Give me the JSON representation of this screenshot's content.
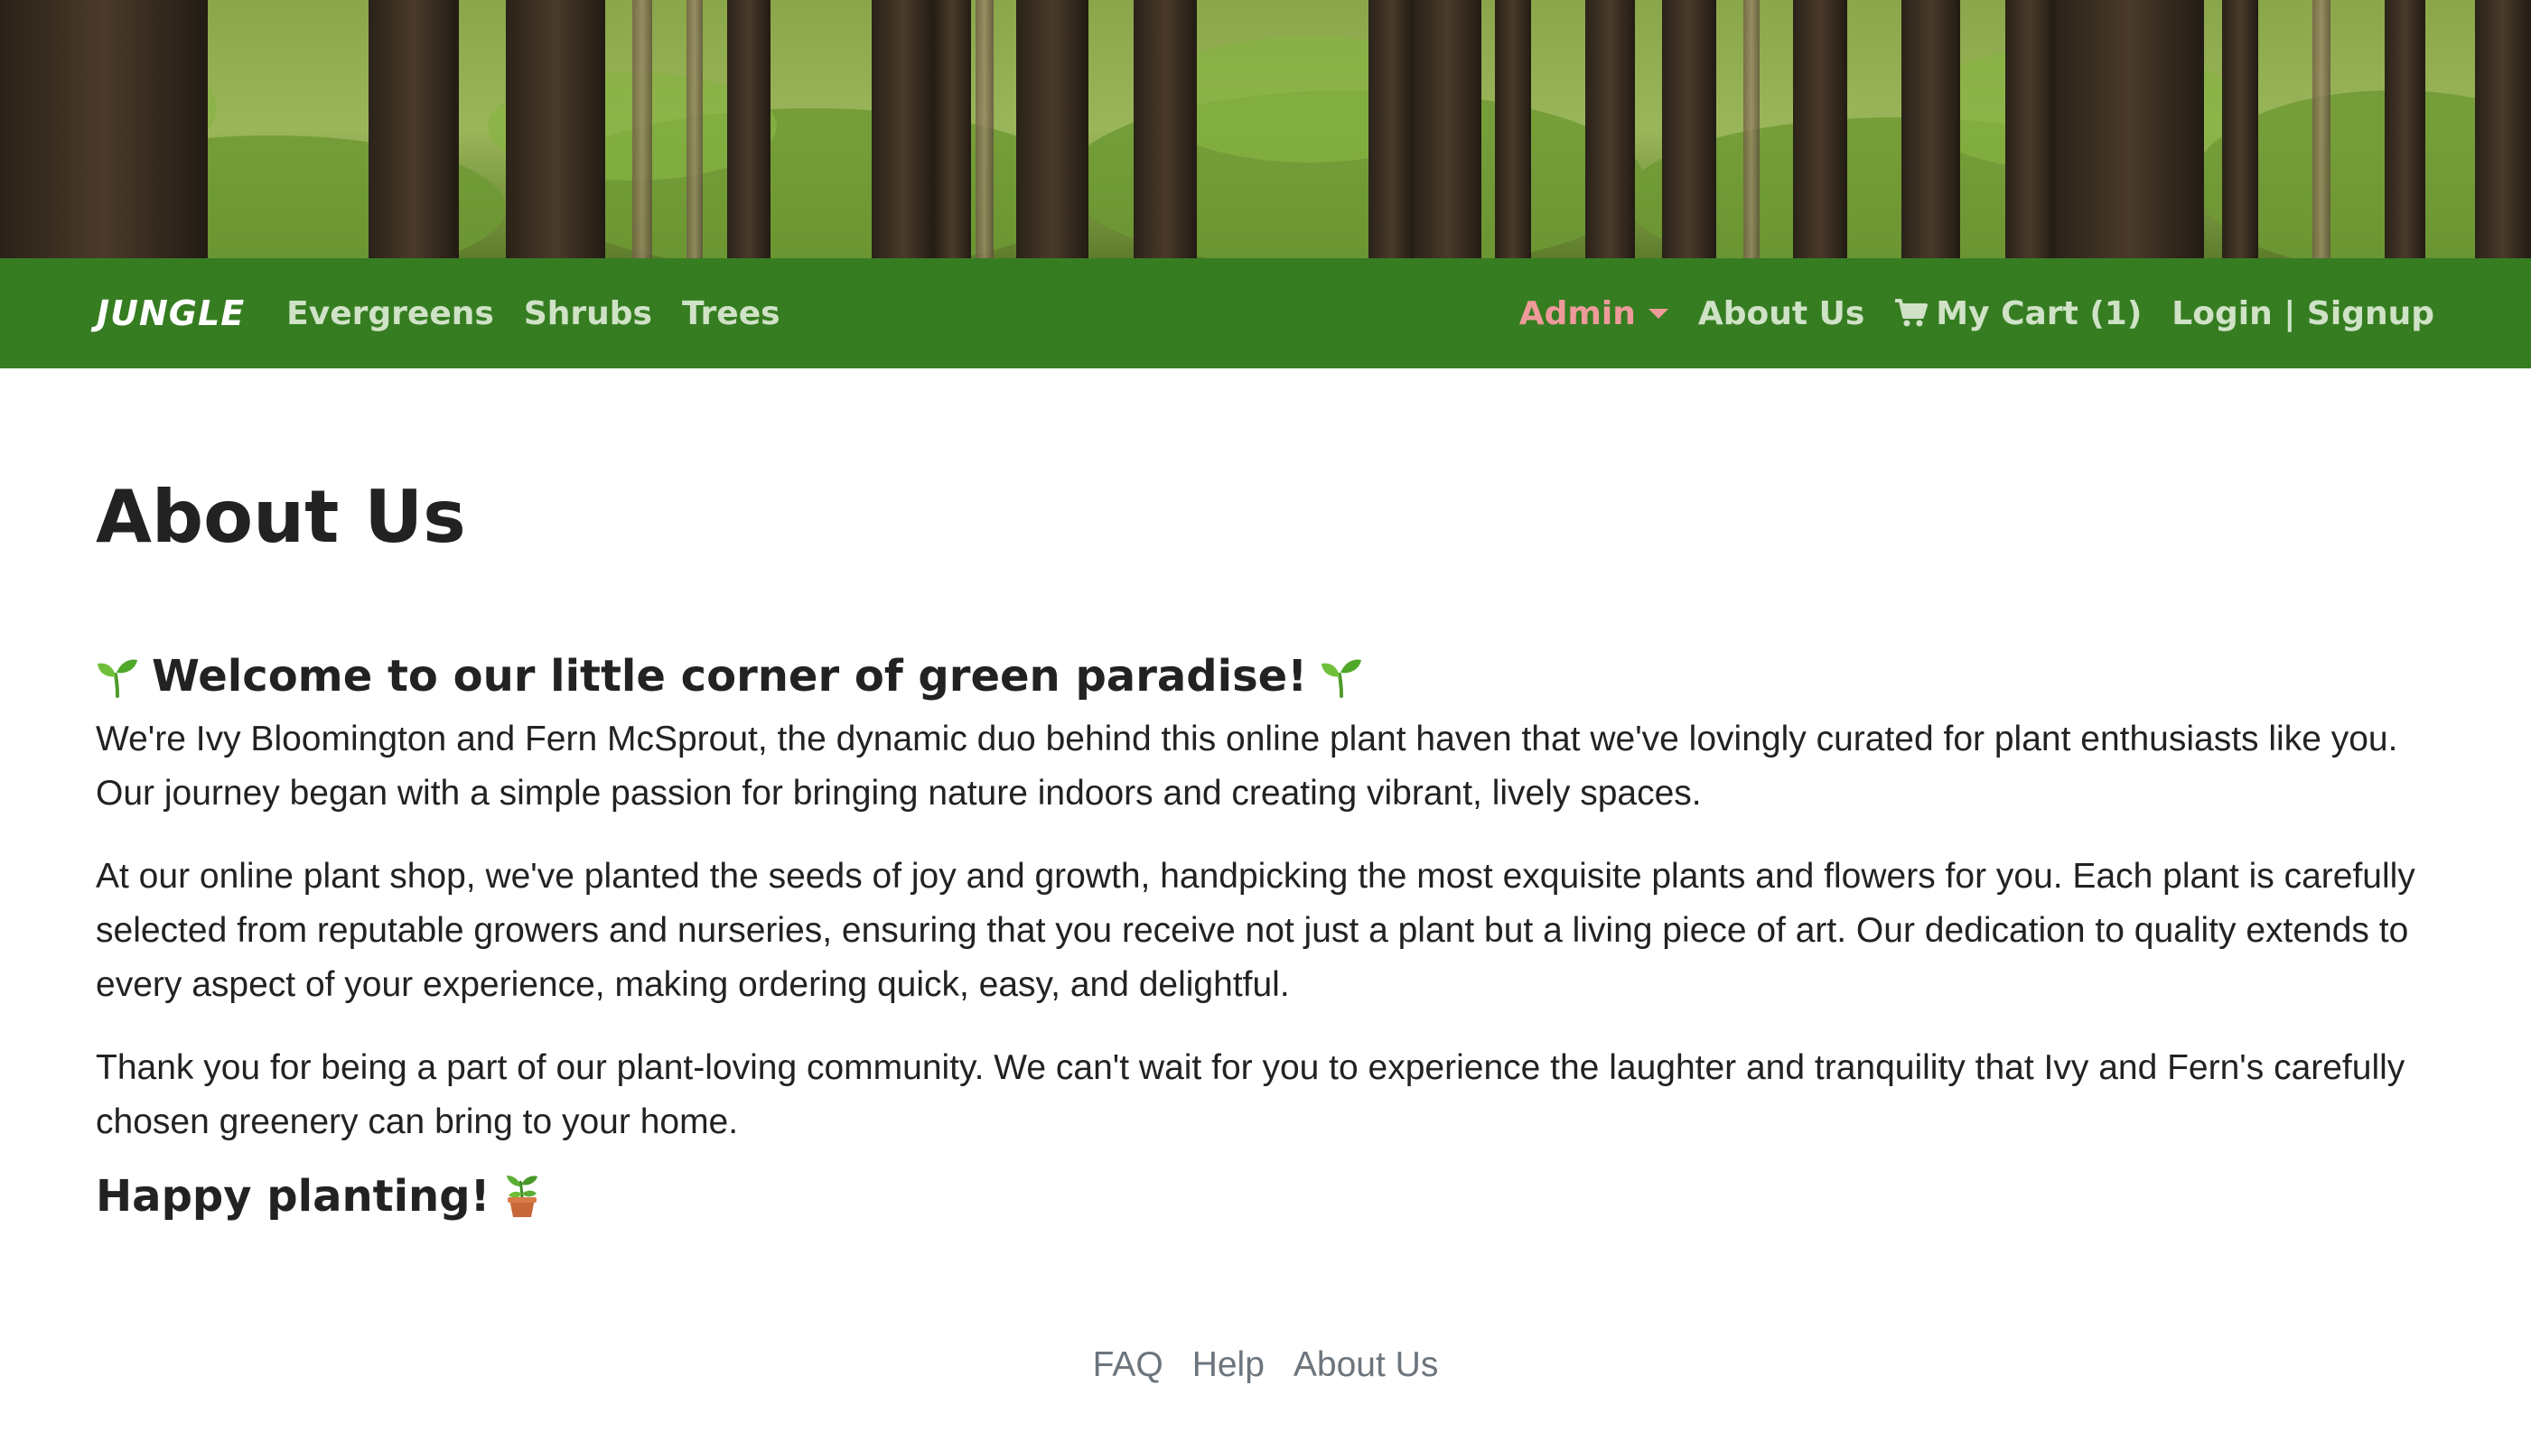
{
  "navbar": {
    "brand": "JUNGLE",
    "left_links": [
      "Evergreens",
      "Shrubs",
      "Trees"
    ],
    "admin_label": "Admin",
    "about_label": "About Us",
    "cart_label": "My Cart (1)",
    "login_label": "Login | Signup",
    "background_color": "#367d22",
    "admin_color": "#ef9a9a",
    "link_color": "#cfe2c6"
  },
  "main": {
    "title": "About Us",
    "welcome_heading": "Welcome to our little corner of green paradise!",
    "paragraphs": [
      "We're Ivy Bloomington and Fern McSprout, the dynamic duo behind this online plant haven that we've lovingly curated for plant enthusiasts like you. Our journey began with a simple passion for bringing nature indoors and creating vibrant, lively spaces.",
      "At our online plant shop, we've planted the seeds of joy and growth, handpicking the most exquisite plants and flowers for you. Each plant is carefully selected from reputable growers and nurseries, ensuring that you receive not just a plant but a living piece of art. Our dedication to quality extends to every aspect of your experience, making ordering quick, easy, and delightful.",
      "Thank you for being a part of our plant-loving community. We can't wait for you to experience the laughter and tranquility that Ivy and Fern's carefully chosen greenery can bring to your home."
    ],
    "closing": "Happy planting!"
  },
  "footer": {
    "links": [
      "FAQ",
      "Help",
      "About Us"
    ]
  },
  "icons": {
    "hero": "forest-banner-image",
    "cart": "cart-icon",
    "sprout": "seedling-icon",
    "pot": "potted-plant-icon",
    "admin_caret": "caret-down-icon"
  }
}
